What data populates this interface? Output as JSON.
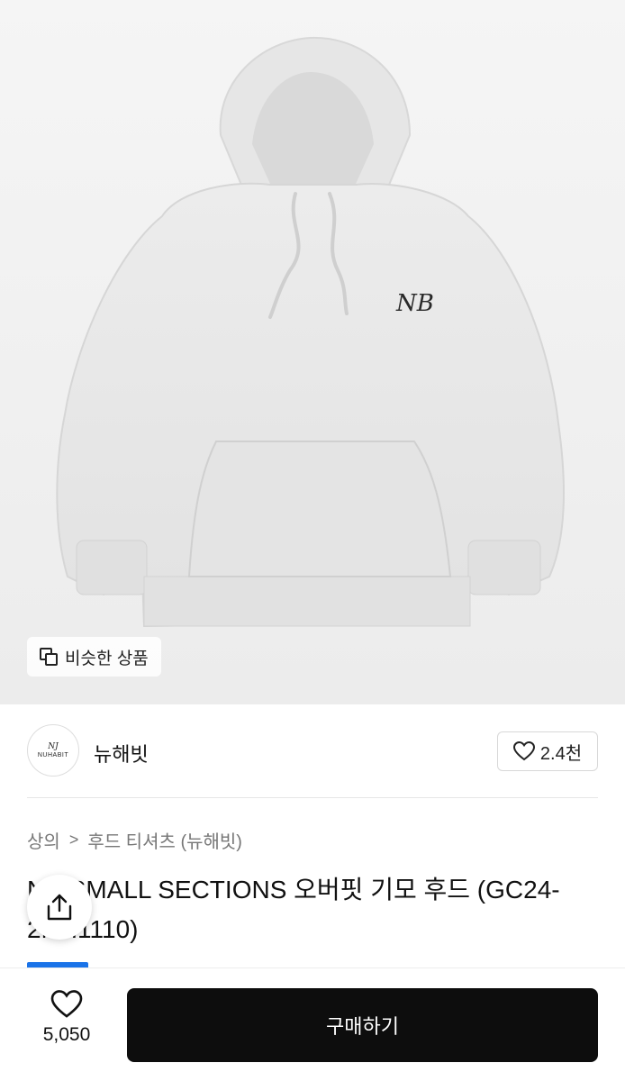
{
  "product_image": {
    "alt": "hoodie",
    "logo_text": "NB"
  },
  "similar_button": {
    "label": "비슷한 상품",
    "icon": "copy-squares-icon"
  },
  "seller": {
    "name": "뉴해빗",
    "avatar_mono": "NJ",
    "avatar_brand": "NUHABIT",
    "like_count": "2.4천",
    "like_icon": "heart-outline-icon"
  },
  "breadcrumb": {
    "items": [
      "상의",
      "후드 티셔츠 (뉴해빗)"
    ],
    "separator": ">"
  },
  "product": {
    "title": "NB SMALL SECTIONS 오버핏 기모 후드 (GC24-2NH1110)"
  },
  "share": {
    "icon": "share-icon"
  },
  "bottom": {
    "wish_count": "5,050",
    "wish_icon": "heart-outline-icon",
    "buy_label": "구매하기"
  },
  "colors": {
    "accent": "#1a73e8",
    "buy_bg": "#0d0d0d",
    "hoodie": "#e9e9e9",
    "inner_hood": "#7a3fa0"
  }
}
